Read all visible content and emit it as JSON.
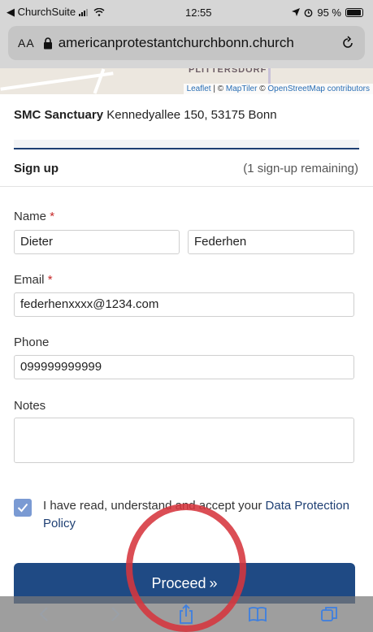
{
  "status_bar": {
    "back_app": "◀ ChurchSuite",
    "time": "12:55",
    "battery": "95 %",
    "battery_level_percent": 95
  },
  "browser": {
    "text_size_label": "AA",
    "url": "americanprotestantchurchbonn.church"
  },
  "map": {
    "place_label": "PLITTERSDORF",
    "attribution_leaflet": "Leaflet",
    "attribution_sep1": " | © ",
    "attribution_maptiler": "MapTiler",
    "attribution_sep2": " © ",
    "attribution_osm": "OpenStreetMap contributors"
  },
  "location": {
    "venue": "SMC Sanctuary",
    "address": "Kennedyallee 150, 53175 Bonn"
  },
  "signup": {
    "title": "Sign up",
    "remaining": "(1 sign-up remaining)"
  },
  "form": {
    "name_label": "Name",
    "required_mark": "*",
    "first_name": "Dieter",
    "last_name": "Federhen",
    "email_label": "Email",
    "email": "federhenxxxx@1234.com",
    "phone_label": "Phone",
    "phone": "099999999999",
    "notes_label": "Notes",
    "notes": ""
  },
  "consent": {
    "checked": true,
    "text": "I have read, understand and accept your",
    "link": "Data Protection Policy"
  },
  "actions": {
    "proceed_label": "Proceed",
    "proceed_icon": "»"
  },
  "colors": {
    "brand": "#1f4a84",
    "required": "#c62828",
    "annotation": "#d6363d"
  }
}
